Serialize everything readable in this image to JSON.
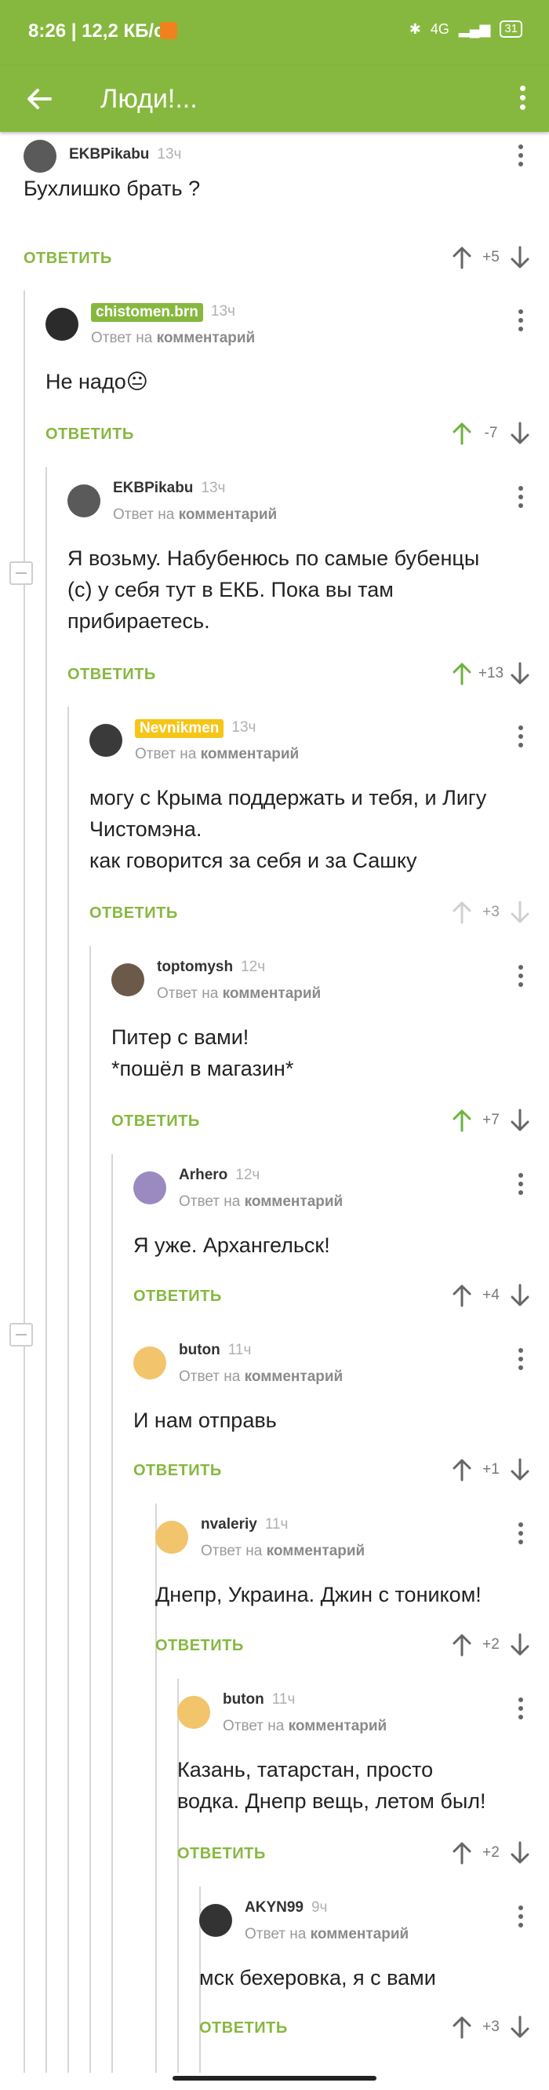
{
  "status": {
    "time": "8:26 | 12,2 КБ/с",
    "signal": "4G",
    "battery": "31"
  },
  "appbar": {
    "title": "Люди!..."
  },
  "labels": {
    "reply": "ОТВЕТИТЬ",
    "reply_to_prefix": "Ответ на",
    "reply_to_target": "комментарий"
  },
  "comments": [
    {
      "author": "EKBPikabu",
      "time": "13ч",
      "is_reply": false,
      "text": "Бухлишко брать ?",
      "score": "+5",
      "vote": "none"
    },
    {
      "author": "chistomen.brn",
      "time": "13ч",
      "is_reply": true,
      "badge": "green",
      "text": "Не надо😐",
      "score": "-7",
      "vote": "up"
    },
    {
      "author": "EKBPikabu",
      "time": "13ч",
      "is_reply": true,
      "text": "Я возьму. Набубенюсь по самые бубенцы\n(с)  у себя тут в ЕКБ. Пока вы там\nприбираетесь.",
      "score": "+13",
      "vote": "up"
    },
    {
      "author": "Nevnikmen",
      "time": "13ч",
      "is_reply": true,
      "badge": "yellow",
      "text": "могу с Крыма поддержать и тебя, и Лигу\nЧистомэна.\nкак говорится за себя и за Сашку",
      "score": "+3",
      "vote": "disabled"
    },
    {
      "author": "toptomysh",
      "time": "12ч",
      "is_reply": true,
      "text": "Питер с вами!\n*пошёл в магазин*",
      "score": "+7",
      "vote": "up"
    },
    {
      "author": "Arhero",
      "time": "12ч",
      "is_reply": true,
      "text": "Я уже. Архангельск!",
      "score": "+4",
      "vote": "none"
    },
    {
      "author": "buton",
      "time": "11ч",
      "is_reply": true,
      "text": "И нам отправь",
      "score": "+1",
      "vote": "none"
    },
    {
      "author": "nvaleriy",
      "time": "11ч",
      "is_reply": true,
      "text": "Днепр, Украина. Джин с тоником!",
      "score": "+2",
      "vote": "none"
    },
    {
      "author": "buton",
      "time": "11ч",
      "is_reply": true,
      "text": "Казань, татарстан, просто\nводка. Днепр вещь, летом был!",
      "score": "+2",
      "vote": "none"
    },
    {
      "author": "AKYN99",
      "time": "9ч",
      "is_reply": true,
      "text": "мск бехеровка, я с вами",
      "score": "+3",
      "vote": "none"
    }
  ]
}
